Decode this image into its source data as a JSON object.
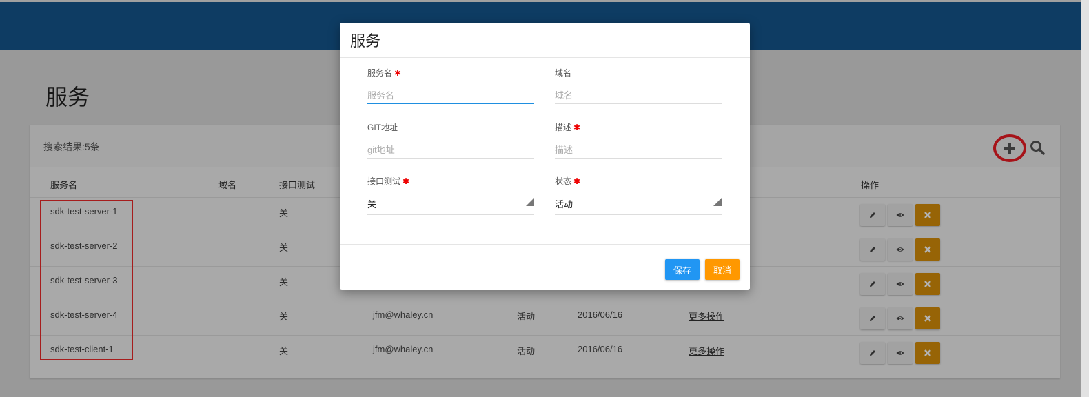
{
  "page": {
    "title": "服务"
  },
  "search": {
    "result_text": "搜索结果:5条"
  },
  "table": {
    "headers": {
      "service_name": "服务名",
      "domain": "域名",
      "api_test": "接口测试",
      "actions": "操作"
    },
    "rows": [
      {
        "name": "sdk-test-server-1",
        "api_test": "关",
        "owner": "",
        "status": "",
        "date": "",
        "more": ""
      },
      {
        "name": "sdk-test-server-2",
        "api_test": "关",
        "owner": "",
        "status": "",
        "date": "",
        "more": ""
      },
      {
        "name": "sdk-test-server-3",
        "api_test": "关",
        "owner": "",
        "status": "",
        "date": "",
        "more": ""
      },
      {
        "name": "sdk-test-server-4",
        "api_test": "关",
        "owner": "jfm@whaley.cn",
        "status": "活动",
        "date": "2016/06/16",
        "more": "更多操作"
      },
      {
        "name": "sdk-test-client-1",
        "api_test": "关",
        "owner": "jfm@whaley.cn",
        "status": "活动",
        "date": "2016/06/16",
        "more": "更多操作"
      }
    ]
  },
  "modal": {
    "title": "服务",
    "fields": {
      "service_name": {
        "label": "服务名",
        "placeholder": "服务名",
        "required": "✱"
      },
      "domain": {
        "label": "域名",
        "placeholder": "域名"
      },
      "git": {
        "label": "GIT地址",
        "placeholder": "git地址"
      },
      "description": {
        "label": "描述",
        "placeholder": "描述",
        "required": "✱"
      },
      "api_test": {
        "label": "接口测试",
        "value": "关",
        "required": "✱"
      },
      "status": {
        "label": "状态",
        "value": "活动",
        "required": "✱"
      }
    },
    "save_label": "保存",
    "cancel_label": "取消"
  },
  "colors": {
    "header": "#15578f",
    "save": "#2196f3",
    "cancel": "#ff9800",
    "delete": "#d9900a",
    "highlight": "#ee1c25",
    "focus": "#1f8fe0"
  },
  "icons": [
    "plus-icon",
    "search-icon",
    "pencil-icon",
    "eye-icon",
    "close-icon",
    "dropdown-triangle-icon"
  ]
}
